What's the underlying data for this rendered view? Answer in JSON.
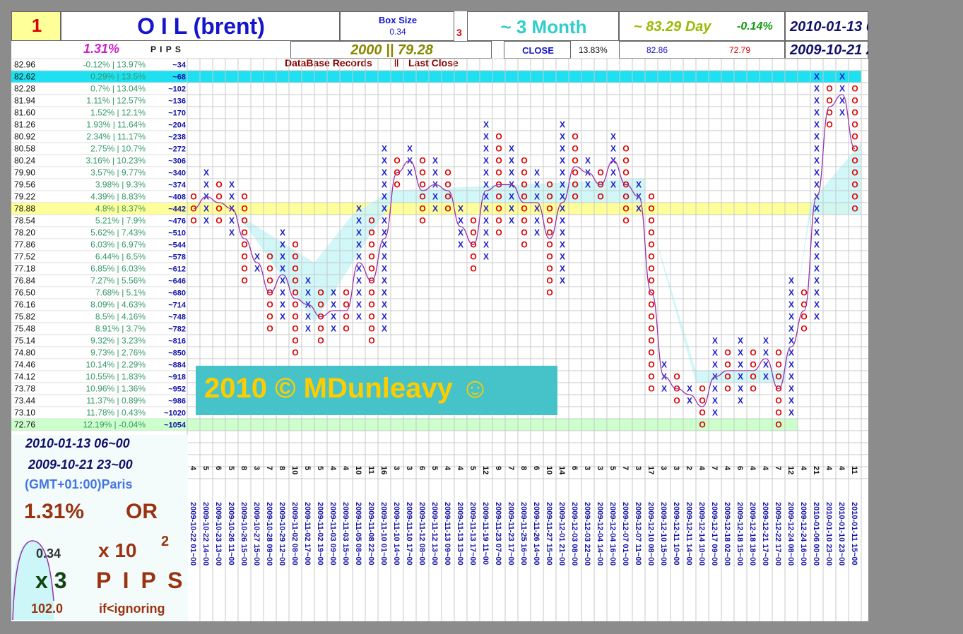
{
  "header": {
    "index": "1",
    "title": "O I L (brent)",
    "box_size_label": "Box Size",
    "box_size": "0.34",
    "reversal": "3",
    "period": "~ 3 Month",
    "day": "~ 83.29 Day",
    "day_change": "-0.14%",
    "date_end": "2010-01-13 06~00",
    "date_start": "2009-10-21 23~00",
    "pct": "1.31%",
    "pips_label": "P I P S",
    "records": "2000 || 79.28",
    "close_label": "CLOSE",
    "close_pct": "13.83%",
    "high": "82.86",
    "low": "72.79",
    "db_label": "DataBase Records",
    "sep": "||",
    "last_close_label": "Last Close"
  },
  "watermark": "2010 © MDunleavy ☺",
  "footer": {
    "date_end": "2010-01-13 06~00",
    "date_start": "2009-10-21 23~00",
    "tz": "(GMT+01:00)Paris",
    "pct": "1.31%",
    "or": "OR",
    "box": "0.34",
    "mult": "x 10",
    "exp": "2",
    "rev": "x 3",
    "pips": "P I P S",
    "ignore_value": "102.0",
    "ignore_label": "if<ignoring"
  },
  "colors": {
    "x_mark": "#1a1acc",
    "o_mark": "#dd0000",
    "cyan_row": "#1ee0f0",
    "yellow_row": "#ffff99",
    "green_row": "#ccffcc",
    "shade": "#ccf6f8",
    "line": "#9933aa"
  },
  "chart_data": {
    "type": "point-and-figure",
    "prices": [
      "82.96",
      "82.62",
      "82.28",
      "81.94",
      "81.60",
      "81.26",
      "80.92",
      "80.58",
      "80.24",
      "79.90",
      "79.56",
      "79.22",
      "78.88",
      "78.54",
      "78.20",
      "77.86",
      "77.52",
      "77.18",
      "76.84",
      "76.50",
      "76.16",
      "75.82",
      "75.48",
      "75.14",
      "74.80",
      "74.46",
      "74.12",
      "73.78",
      "73.44",
      "73.10",
      "72.76"
    ],
    "pcts": [
      "-0.12% | 13.97%",
      "0.29% | 13.5%",
      "0.7% | 13.04%",
      "1.11% | 12.57%",
      "1.52% | 12.1%",
      "1.93% | 11.64%",
      "2.34% | 11.17%",
      "2.75% | 10.7%",
      "3.16% | 10.23%",
      "3.57% | 9.77%",
      "3.98% | 9.3%",
      "4.39% | 8.83%",
      "4.8% | 8.37%",
      "5.21% | 7.9%",
      "5.62% | 7.43%",
      "6.03% | 6.97%",
      "6.44% | 6.5%",
      "6.85% | 6.03%",
      "7.27% | 5.56%",
      "7.68% | 5.1%",
      "8.09% | 4.63%",
      "8.5% | 4.16%",
      "8.91% | 3.7%",
      "9.32% | 3.23%",
      "9.73% | 2.76%",
      "10.14% | 2.29%",
      "10.55% | 1.83%",
      "10.96% | 1.36%",
      "11.37% | 0.89%",
      "11.78% | 0.43%",
      "12.19% | -0.04%"
    ],
    "pips": [
      "~34",
      "~68",
      "~102",
      "~136",
      "~170",
      "~204",
      "~238",
      "~272",
      "~306",
      "~340",
      "~374",
      "~408",
      "~442",
      "~476",
      "~510",
      "~544",
      "~578",
      "~612",
      "~646",
      "~680",
      "~714",
      "~748",
      "~782",
      "~816",
      "~850",
      "~884",
      "~918",
      "~952",
      "~986",
      "~1020",
      "~1054"
    ],
    "highlight_rows": {
      "cyan": 1,
      "yellow": 12,
      "green": 30
    },
    "columns": [
      {
        "kind": "O",
        "from": 11,
        "to": 13,
        "count": "4",
        "date": "2009-10-22 01~00"
      },
      {
        "kind": "X",
        "from": 9,
        "to": 13,
        "count": "5",
        "date": "2009-10-22 14~00"
      },
      {
        "kind": "O",
        "from": 10,
        "to": 13,
        "count": "6",
        "date": "2009-10-23 13~00"
      },
      {
        "kind": "X",
        "from": 10,
        "to": 14,
        "count": "5",
        "date": "2009-10-26 11~00"
      },
      {
        "kind": "O",
        "from": 11,
        "to": 18,
        "count": "8",
        "date": "2009-10-26 15~00"
      },
      {
        "kind": "X",
        "from": 16,
        "to": 17,
        "count": "3",
        "date": "2009-10-27 15~00"
      },
      {
        "kind": "O",
        "from": 16,
        "to": 22,
        "count": "7",
        "date": "2009-10-28 09~00"
      },
      {
        "kind": "X",
        "from": 14,
        "to": 21,
        "count": "8",
        "date": "2009-10-29 12~00"
      },
      {
        "kind": "O",
        "from": 15,
        "to": 24,
        "count": "10",
        "date": "2009-11-02 08~00"
      },
      {
        "kind": "X",
        "from": 18,
        "to": 22,
        "count": "5",
        "date": "2009-11-02 17~00"
      },
      {
        "kind": "O",
        "from": 19,
        "to": 23,
        "count": "5",
        "date": "2009-11-02 19~00"
      },
      {
        "kind": "X",
        "from": 19,
        "to": 22,
        "count": "4",
        "date": "2009-11-03 09~00"
      },
      {
        "kind": "O",
        "from": 19,
        "to": 22,
        "count": "4",
        "date": "2009-11-03 15~00"
      },
      {
        "kind": "X",
        "from": 12,
        "to": 21,
        "count": "10",
        "date": "2009-11-05 08~00"
      },
      {
        "kind": "O",
        "from": 13,
        "to": 23,
        "count": "11",
        "date": "2009-11-08 22~00"
      },
      {
        "kind": "X",
        "from": 7,
        "to": 22,
        "count": "16",
        "date": "2009-11-10 01~00"
      },
      {
        "kind": "O",
        "from": 8,
        "to": 10,
        "count": "3",
        "date": "2009-11-10 14~00"
      },
      {
        "kind": "X",
        "from": 7,
        "to": 9,
        "count": "3",
        "date": "2009-11-10 17~00"
      },
      {
        "kind": "O",
        "from": 8,
        "to": 13,
        "count": "6",
        "date": "2009-11-12 08~00"
      },
      {
        "kind": "X",
        "from": 8,
        "to": 12,
        "count": "5",
        "date": "2009-11-12 13~00"
      },
      {
        "kind": "O",
        "from": 9,
        "to": 12,
        "count": "4",
        "date": "2009-11-13 09~00"
      },
      {
        "kind": "X",
        "from": 12,
        "to": 15,
        "count": "4",
        "date": "2009-11-13 13~00"
      },
      {
        "kind": "O",
        "from": 13,
        "to": 17,
        "count": "5",
        "date": "2009-11-13 17~00"
      },
      {
        "kind": "X",
        "from": 5,
        "to": 16,
        "count": "12",
        "date": "2009-11-19 11~00"
      },
      {
        "kind": "O",
        "from": 6,
        "to": 14,
        "count": "9",
        "date": "2009-11-23 07~00"
      },
      {
        "kind": "X",
        "from": 7,
        "to": 13,
        "count": "7",
        "date": "2009-11-23 17~00"
      },
      {
        "kind": "O",
        "from": 8,
        "to": 15,
        "count": "8",
        "date": "2009-11-25 16~00"
      },
      {
        "kind": "X",
        "from": 9,
        "to": 14,
        "count": "6",
        "date": "2009-11-26 14~00"
      },
      {
        "kind": "O",
        "from": 10,
        "to": 19,
        "count": "10",
        "date": "2009-11-27 15~00"
      },
      {
        "kind": "X",
        "from": 5,
        "to": 18,
        "count": "14",
        "date": "2009-12-01 21~00"
      },
      {
        "kind": "O",
        "from": 6,
        "to": 11,
        "count": "6",
        "date": "2009-12-03 08~00"
      },
      {
        "kind": "X",
        "from": 8,
        "to": 10,
        "count": "3",
        "date": "2009-12-03 22~00"
      },
      {
        "kind": "O",
        "from": 9,
        "to": 11,
        "count": "3",
        "date": "2009-12-04 14~00"
      },
      {
        "kind": "X",
        "from": 6,
        "to": 10,
        "count": "5",
        "date": "2009-12-04 16~00"
      },
      {
        "kind": "O",
        "from": 7,
        "to": 13,
        "count": "7",
        "date": "2009-12-07 01~00"
      },
      {
        "kind": "X",
        "from": 10,
        "to": 12,
        "count": "3",
        "date": "2009-12-07 11~00"
      },
      {
        "kind": "O",
        "from": 11,
        "to": 27,
        "count": "17",
        "date": "2009-12-10 08~00"
      },
      {
        "kind": "X",
        "from": 25,
        "to": 27,
        "count": "3",
        "date": "2009-12-10 15~00"
      },
      {
        "kind": "O",
        "from": 26,
        "to": 28,
        "count": "3",
        "date": "2009-12-11 10~00"
      },
      {
        "kind": "X",
        "from": 27,
        "to": 28,
        "count": "2",
        "date": "2009-12-11 14~00"
      },
      {
        "kind": "O",
        "from": 27,
        "to": 30,
        "count": "4",
        "date": "2009-12-14 10~00"
      },
      {
        "kind": "X",
        "from": 23,
        "to": 29,
        "count": "7",
        "date": "2009-12-17 09~00"
      },
      {
        "kind": "O",
        "from": 24,
        "to": 27,
        "count": "4",
        "date": "2009-12-18 02~00"
      },
      {
        "kind": "X",
        "from": 23,
        "to": 28,
        "count": "6",
        "date": "2009-12-18 15~00"
      },
      {
        "kind": "O",
        "from": 24,
        "to": 27,
        "count": "4",
        "date": "2009-12-18 18~00"
      },
      {
        "kind": "X",
        "from": 23,
        "to": 26,
        "count": "4",
        "date": "2009-12-21 17~00"
      },
      {
        "kind": "O",
        "from": 24,
        "to": 30,
        "count": "7",
        "date": "2009-12-22 17~00"
      },
      {
        "kind": "X",
        "from": 18,
        "to": 29,
        "count": "12",
        "date": "2009-12-24 08~00"
      },
      {
        "kind": "O",
        "from": 19,
        "to": 22,
        "count": "4",
        "date": "2009-12-24 16~00"
      },
      {
        "kind": "X",
        "from": 1,
        "to": 21,
        "count": "21",
        "date": "2010-01-06 00~00"
      },
      {
        "kind": "O",
        "from": 2,
        "to": 5,
        "count": "4",
        "date": "2010-01-10 23~00"
      },
      {
        "kind": "X",
        "from": 1,
        "to": 4,
        "count": "4",
        "date": "2010-01-10 23~00"
      },
      {
        "kind": "O",
        "from": 2,
        "to": 12,
        "count": "11",
        "date": "2010-01-11 15~00"
      }
    ]
  }
}
